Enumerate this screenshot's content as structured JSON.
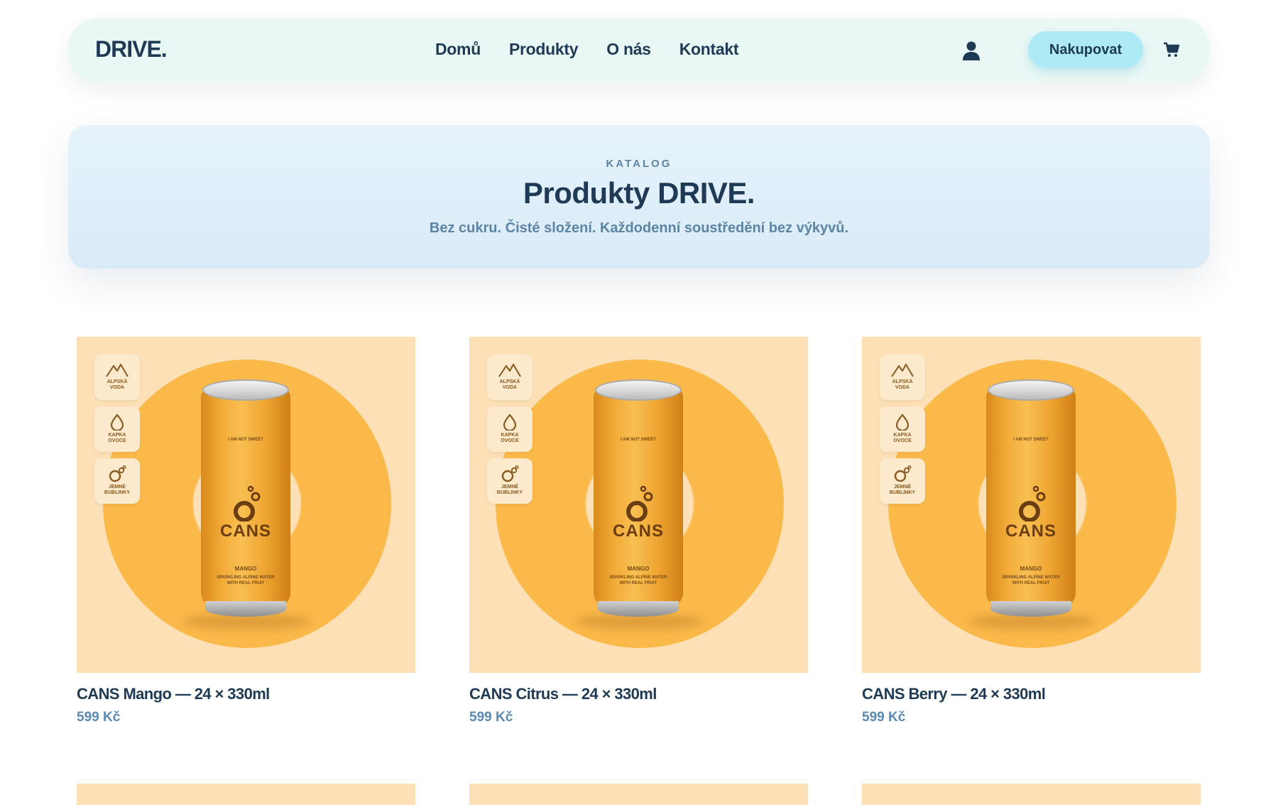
{
  "nav": {
    "logo": "DRIVE.",
    "links": [
      "Domů",
      "Produkty",
      "O nás",
      "Kontakt"
    ],
    "cta": "Nakupovat"
  },
  "hero": {
    "eyebrow": "KATALOG",
    "title": "Produkty DRIVE.",
    "subtitle": "Bez cukru. Čisté složení. Každodenní soustředění bez výkyvů."
  },
  "product_image": {
    "badges": [
      {
        "line1": "ALPSKÁ",
        "line2": "VODA",
        "icon": "mountain-icon"
      },
      {
        "line1": "KAPKA",
        "line2": "OVOCE",
        "icon": "drop-icon"
      },
      {
        "line1": "JEMNÉ",
        "line2": "BUBLINKY",
        "icon": "bubbles-icon"
      }
    ],
    "can_tagline": "I AM NOT SWEET",
    "can_brand": "CANS",
    "can_flavor": "MANGO",
    "can_desc1": "SPARKLING ALPINE WATER",
    "can_desc2": "WITH REAL FRUIT"
  },
  "products": [
    {
      "name": "CANS Mango — 24 × 330ml",
      "price": "599 Kč"
    },
    {
      "name": "CANS Citrus — 24 × 330ml",
      "price": "599 Kč"
    },
    {
      "name": "CANS Berry — 24 × 330ml",
      "price": "599 Kč"
    }
  ],
  "colors": {
    "primary_text": "#1f3a54",
    "accent_button": "#aee9f6",
    "price": "#5a89b3",
    "product_bg": "#fde0b5",
    "ring": "#fbb94a"
  }
}
